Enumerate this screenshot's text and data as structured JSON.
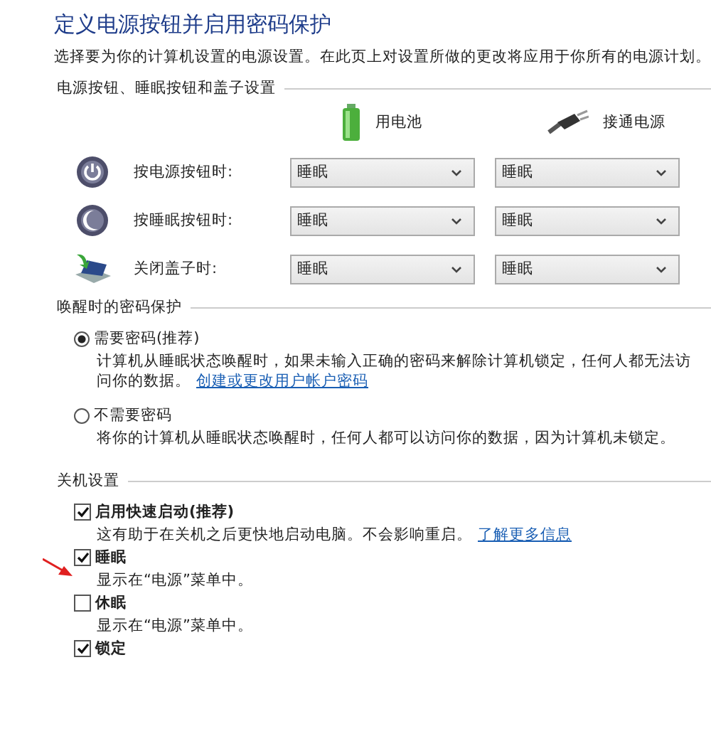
{
  "title": "定义电源按钮并启用密码保护",
  "intro": "选择要为你的计算机设置的电源设置。在此页上对设置所做的更改将应用于你所有的电源计划。",
  "buttons_section": {
    "heading": "电源按钮、睡眠按钮和盖子设置",
    "columns": [
      {
        "label": "用电池",
        "kind": "battery"
      },
      {
        "label": "接通电源",
        "kind": "plug"
      }
    ],
    "rows": [
      {
        "label": "按电源按钮时:",
        "kind": "power",
        "values": [
          "睡眠",
          "睡眠"
        ]
      },
      {
        "label": "按睡眠按钮时:",
        "kind": "sleep",
        "values": [
          "睡眠",
          "睡眠"
        ]
      },
      {
        "label": "关闭盖子时:",
        "kind": "lid",
        "values": [
          "睡眠",
          "睡眠"
        ]
      }
    ]
  },
  "password_section": {
    "heading": "唤醒时的密码保护",
    "options": [
      {
        "label": "需要密码(推荐)",
        "selected": true,
        "description": "计算机从睡眠状态唤醒时，如果未输入正确的密码来解除计算机锁定，任何人都无法访问你的数据。",
        "link": "创建或更改用户帐户密码"
      },
      {
        "label": "不需要密码",
        "selected": false,
        "description": "将你的计算机从睡眠状态唤醒时，任何人都可以访问你的数据，因为计算机未锁定。"
      }
    ]
  },
  "shutdown_section": {
    "heading": "关机设置",
    "items": [
      {
        "label": "启用快速启动(推荐)",
        "checked": true,
        "description": "这有助于在关机之后更快地启动电脑。不会影响重启。",
        "link": "了解更多信息"
      },
      {
        "label": "睡眠",
        "checked": true,
        "description": "显示在“电源”菜单中。"
      },
      {
        "label": "休眠",
        "checked": false,
        "description": "显示在“电源”菜单中。"
      },
      {
        "label": "锁定",
        "checked": true
      }
    ]
  }
}
